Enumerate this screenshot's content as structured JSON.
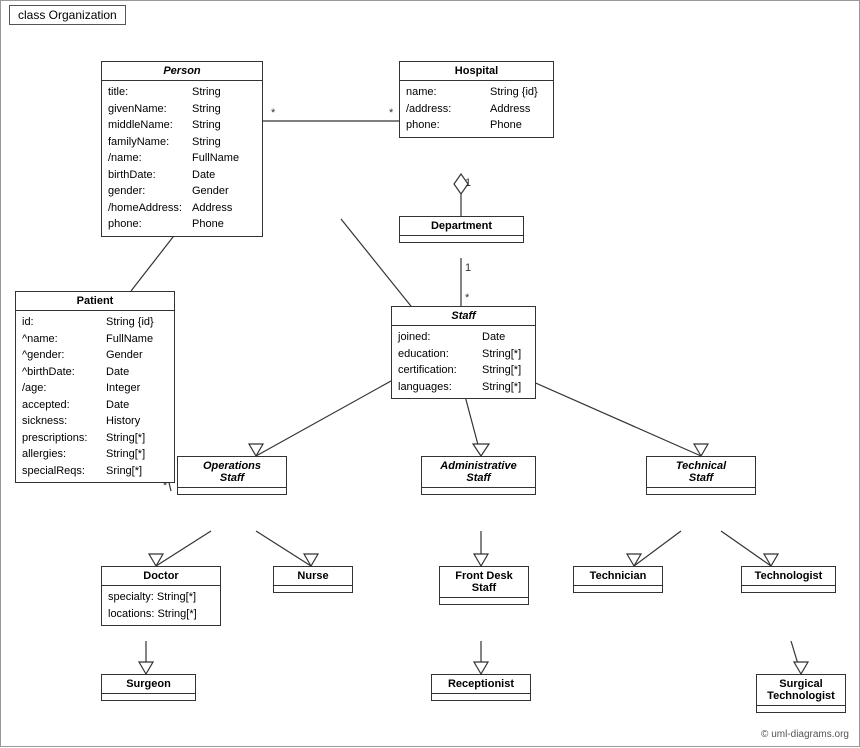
{
  "title": "class Organization",
  "classes": {
    "person": {
      "name": "Person",
      "italic": true,
      "attrs": [
        {
          "name": "title:",
          "type": "String"
        },
        {
          "name": "givenName:",
          "type": "String"
        },
        {
          "name": "middleName:",
          "type": "String"
        },
        {
          "name": "familyName:",
          "type": "String"
        },
        {
          "name": "/name:",
          "type": "FullName"
        },
        {
          "name": "birthDate:",
          "type": "Date"
        },
        {
          "name": "gender:",
          "type": "Gender"
        },
        {
          "name": "/homeAddress:",
          "type": "Address"
        },
        {
          "name": "phone:",
          "type": "Phone"
        }
      ]
    },
    "hospital": {
      "name": "Hospital",
      "italic": false,
      "attrs": [
        {
          "name": "name:",
          "type": "String {id}"
        },
        {
          "name": "/address:",
          "type": "Address"
        },
        {
          "name": "phone:",
          "type": "Phone"
        }
      ]
    },
    "patient": {
      "name": "Patient",
      "italic": false,
      "attrs": [
        {
          "name": "id:",
          "type": "String {id}"
        },
        {
          "name": "^name:",
          "type": "FullName"
        },
        {
          "name": "^gender:",
          "type": "Gender"
        },
        {
          "name": "^birthDate:",
          "type": "Date"
        },
        {
          "name": "/age:",
          "type": "Integer"
        },
        {
          "name": "accepted:",
          "type": "Date"
        },
        {
          "name": "sickness:",
          "type": "History"
        },
        {
          "name": "prescriptions:",
          "type": "String[*]"
        },
        {
          "name": "allergies:",
          "type": "String[*]"
        },
        {
          "name": "specialReqs:",
          "type": "Sring[*]"
        }
      ]
    },
    "department": {
      "name": "Department",
      "italic": false,
      "attrs": []
    },
    "staff": {
      "name": "Staff",
      "italic": true,
      "attrs": [
        {
          "name": "joined:",
          "type": "Date"
        },
        {
          "name": "education:",
          "type": "String[*]"
        },
        {
          "name": "certification:",
          "type": "String[*]"
        },
        {
          "name": "languages:",
          "type": "String[*]"
        }
      ]
    },
    "operations_staff": {
      "name": "Operations Staff",
      "italic": true,
      "attrs": []
    },
    "administrative_staff": {
      "name": "Administrative Staff",
      "italic": true,
      "attrs": []
    },
    "technical_staff": {
      "name": "Technical Staff",
      "italic": true,
      "attrs": []
    },
    "doctor": {
      "name": "Doctor",
      "italic": false,
      "attrs": [
        {
          "name": "specialty:",
          "type": "String[*]"
        },
        {
          "name": "locations:",
          "type": "String[*]"
        }
      ]
    },
    "nurse": {
      "name": "Nurse",
      "italic": false,
      "attrs": []
    },
    "front_desk_staff": {
      "name": "Front Desk Staff",
      "italic": false,
      "attrs": []
    },
    "technician": {
      "name": "Technician",
      "italic": false,
      "attrs": []
    },
    "technologist": {
      "name": "Technologist",
      "italic": false,
      "attrs": []
    },
    "surgeon": {
      "name": "Surgeon",
      "italic": false,
      "attrs": []
    },
    "receptionist": {
      "name": "Receptionist",
      "italic": false,
      "attrs": []
    },
    "surgical_technologist": {
      "name": "Surgical Technologist",
      "italic": false,
      "attrs": []
    }
  },
  "labels": {
    "star1": "*",
    "star2": "*",
    "star3": "*",
    "one1": "1",
    "one2": "1",
    "copyright": "© uml-diagrams.org"
  }
}
